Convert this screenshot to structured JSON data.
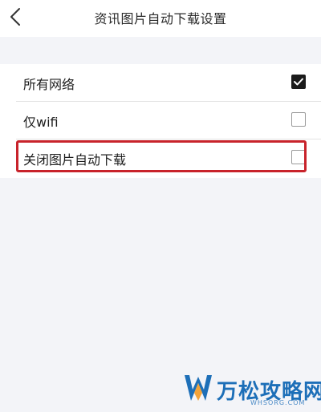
{
  "header": {
    "title": "资讯图片自动下载设置",
    "back_icon": "chevron-left-icon"
  },
  "options": [
    {
      "label": "所有网络",
      "checked": true
    },
    {
      "label": "仅wifi",
      "checked": false
    },
    {
      "label": "关闭图片自动下载",
      "checked": false
    }
  ],
  "highlight_color": "#c8232b",
  "watermark": {
    "logo_icon": "w-logo-icon",
    "text": "万松攻略网",
    "subtext": "WHSORG.COM",
    "color": "#1d6fb8"
  }
}
